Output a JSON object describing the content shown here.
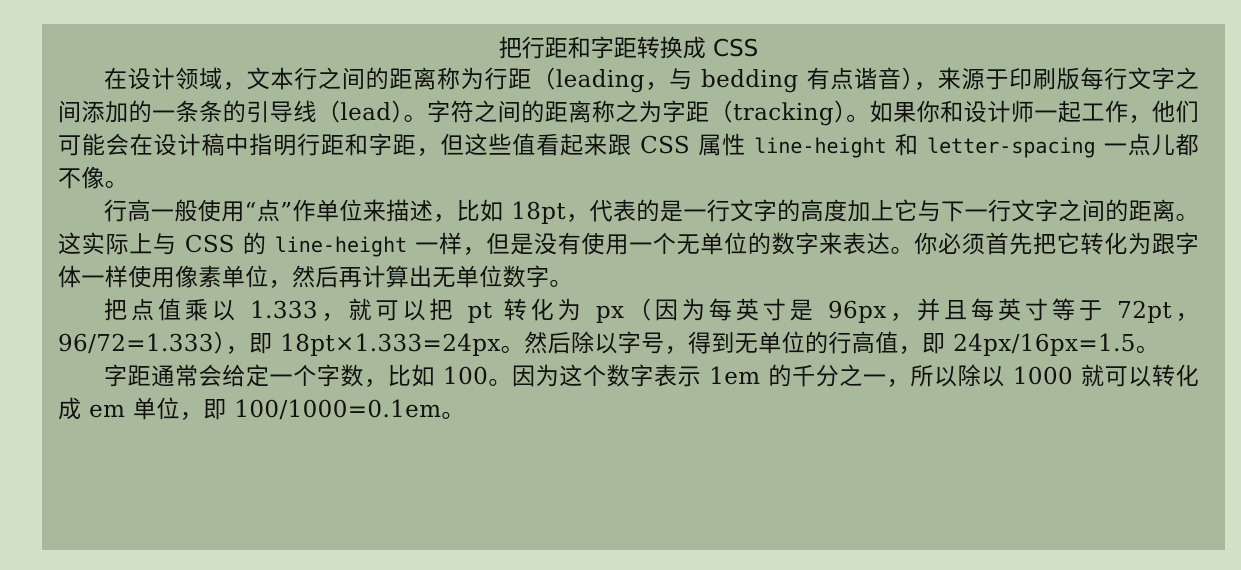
{
  "title": "把行距和字距转换成 CSS",
  "paragraphs": [
    {
      "p1_a": "在设计领域，文本行之间的距离称为",
      "p1_term1": "行距",
      "p1_b": "（leading，与 bedding 有点谐音），来源于印刷版每行文字之间添加的一条条的引导线（lead）。字符之间的距离称之为",
      "p1_term2": "字距",
      "p1_c": "（tracking）。如果你和设计师一起工作，他们可能会在设计稿中指明行距和字距，但这些值看起来跟 CSS 属性 ",
      "p1_code1": "line-height",
      "p1_d": " 和 ",
      "p1_code2": "letter-spacing",
      "p1_e": " 一点儿都不像。"
    },
    {
      "p2_a": "行高一般使用“点”作单位来描述，比如 18pt，代表的是一行文字的高度加上它与下一行文字之间的距离。这实际上与 CSS 的 ",
      "p2_code": "line-height",
      "p2_b": " 一样，但是没有使用一个无单位的数字来表达。你必须首先把它转化为跟字体一样使用像素单位，然后再计算出无单位数字。"
    },
    {
      "p3": "把点值乘以 1.333，就可以把 pt 转化为 px（因为每英寸是 96px，并且每英寸等于 72pt，96/72=1.333），即 18pt×1.333=24px。然后除以字号，得到无单位的行高值，即 24px/16px=1.5。"
    },
    {
      "p4": "字距通常会给定一个字数，比如 100。因为这个数字表示 1em 的千分之一，所以除以 1000 就可以转化成 em 单位，即 100/1000=0.1em。"
    }
  ]
}
